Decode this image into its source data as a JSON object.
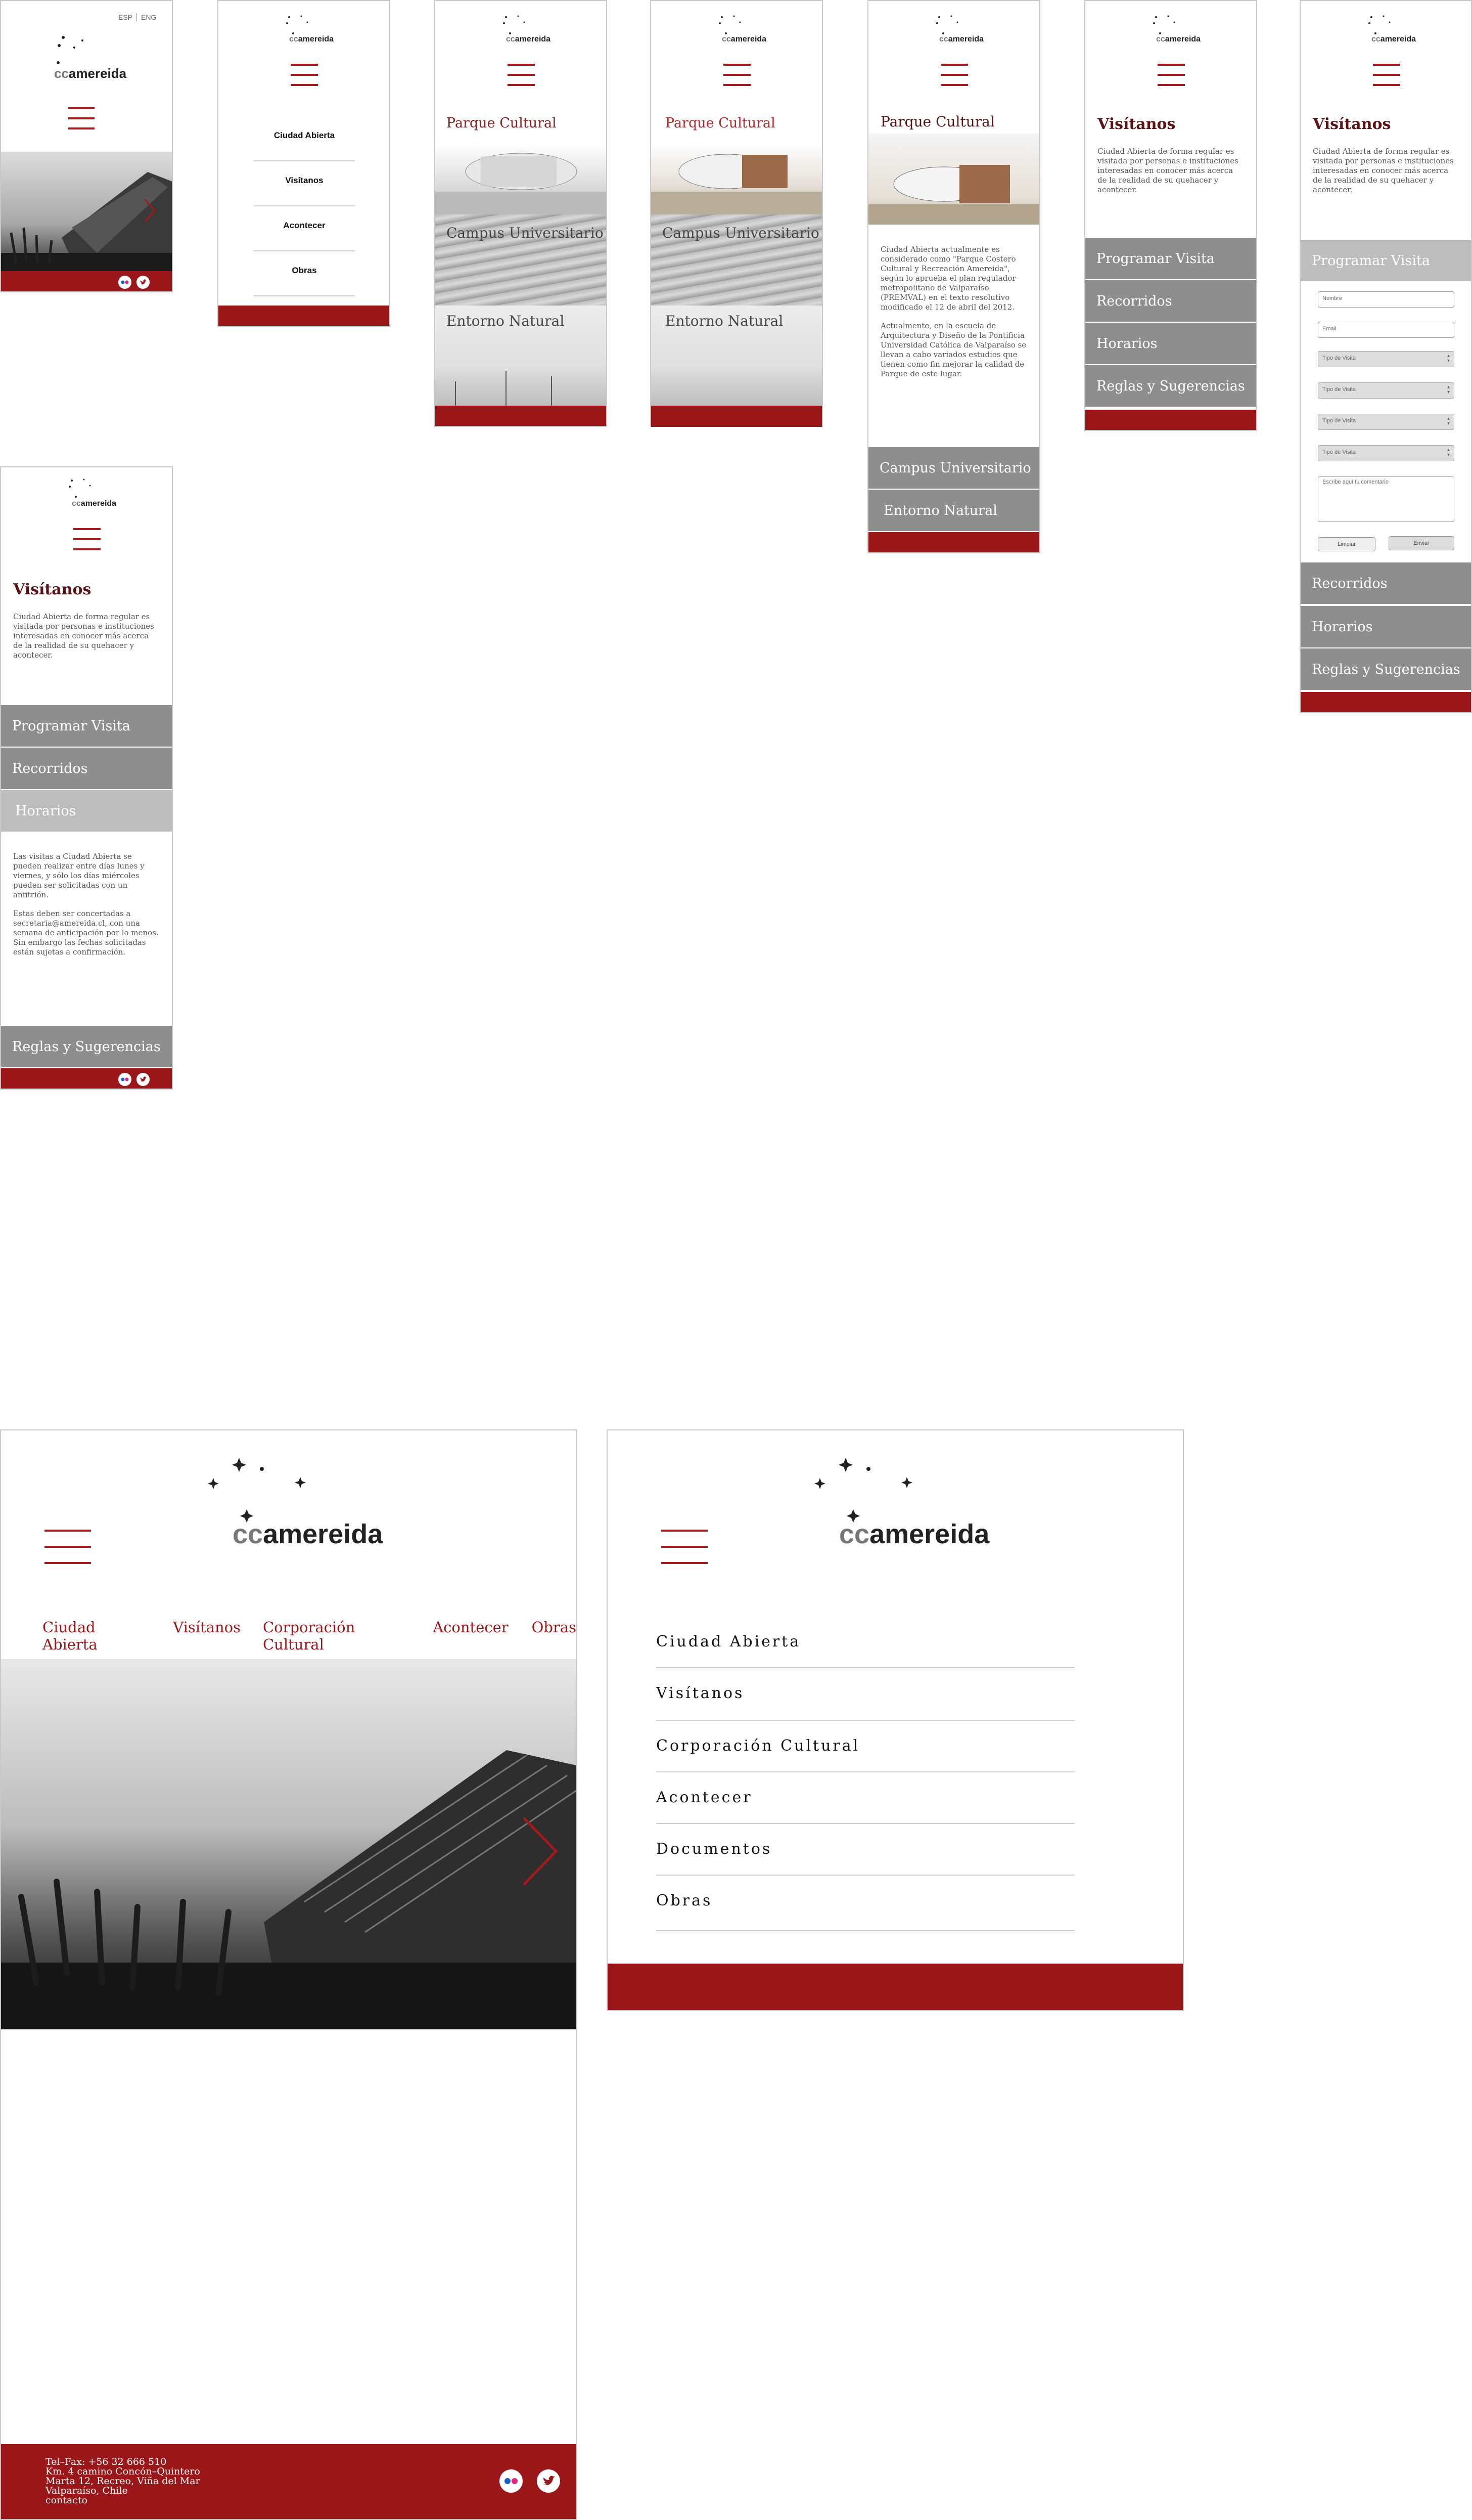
{
  "brand": {
    "cc": "cc",
    "name": "amereida"
  },
  "lang": {
    "esp": "ESP",
    "eng": "ENG"
  },
  "menu_mobile": [
    "Ciudad Abierta",
    "Visítanos",
    "Acontecer",
    "Obras"
  ],
  "ciudad_abierta": {
    "sections": [
      "Parque Cultural",
      "Campus Universitario",
      "Entorno Natural"
    ],
    "parque_text": "Ciudad Abierta actualmente es considerado como \"Parque Costero Cultural y Recreación Amereida\", según lo aprueba el plan regulador metropolitano de Valparaíso (PREMVAL) en el texto resolutivo modificado el 12 de abril del 2012.",
    "parque_text2": "Actualmente, en la escuela de Arquitectura y Diseño de la Pontificia Universidad Católica de Valparaíso se llevan a cabo variados estudios que tienen como fin mejorar la calidad de Parque de este lugar."
  },
  "visitanos": {
    "title": "Visítanos",
    "intro": "Ciudad Abierta de forma regular es visitada por personas e instituciones interesadas en conocer más acerca de la realidad de su quehacer y acontecer.",
    "items": [
      "Programar Visita",
      "Recorridos",
      "Horarios",
      "Reglas y Sugerencias"
    ],
    "form": {
      "nombre": "Nombre",
      "email": "Email",
      "tipo": "Tipo de Visita",
      "comentario": "Escribe aquí tu comentario",
      "limpiar": "Limpiar",
      "enviar": "Enviar"
    },
    "horarios_text": "Las visitas a Ciudad Abierta se pueden realizar entre días lunes y viernes, y sólo los días miércoles pueden ser solicitadas con un anfitrión.",
    "horarios_text2": "Estas deben ser concertadas a secretaria@amereida.cl, con una semana de anticipación por lo menos. Sin embargo las fechas solicitadas están sujetas a confirmación."
  },
  "desktop": {
    "nav": [
      "Ciudad Abierta",
      "Visítanos",
      "Corporación Cultural",
      "Acontecer",
      "Obras"
    ],
    "footer": [
      "Tel–Fax: +56 32 666 510",
      "Km. 4 camino Concón–Quintero",
      "Marta 12, Recreo, Viña del Mar",
      "Valparaíso, Chile",
      "contacto"
    ]
  },
  "desktop_menu": [
    "Ciudad Abierta",
    "Visítanos",
    "Corporación Cultural",
    "Acontecer",
    "Documentos",
    "Obras"
  ],
  "colors": {
    "accent": "#9b1618",
    "title": "#5a1214",
    "gray": "#8e8e8e"
  },
  "icons": [
    "flickr-icon",
    "twitter-icon",
    "hamburger-menu-icon",
    "next-arrow-icon",
    "select-arrows-icon"
  ]
}
